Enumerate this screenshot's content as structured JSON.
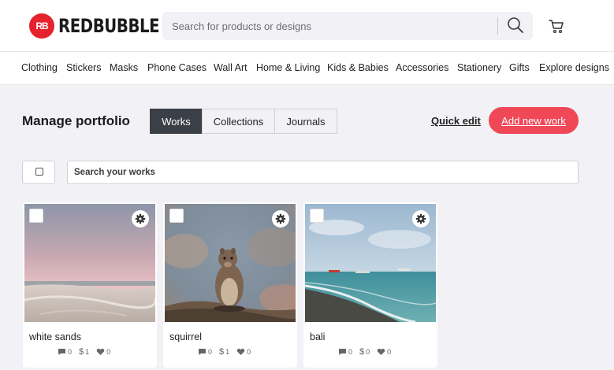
{
  "brand": {
    "mark": "RB",
    "name": "REDBUBBLE",
    "color": "#e4232d"
  },
  "search": {
    "placeholder": "Search for products or designs"
  },
  "icons": {
    "search": "search-icon",
    "cart": "cart-icon",
    "gear": "gear-icon",
    "comment": "comment-icon",
    "heart": "heart-icon"
  },
  "nav": {
    "items": [
      "Clothing",
      "Stickers",
      "Masks",
      "Phone Cases",
      "Wall Art",
      "Home & Living",
      "Kids & Babies",
      "Accessories",
      "Stationery",
      "Gifts",
      "Explore designs"
    ]
  },
  "portfolio": {
    "title": "Manage portfolio",
    "tabs": [
      "Works",
      "Collections",
      "Journals"
    ],
    "active_tab": "Works",
    "quick_edit": "Quick edit",
    "add_work": "Add new work",
    "works_search_placeholder": "Search your works"
  },
  "works": [
    {
      "title": "white sands",
      "comments": "0",
      "sales": "1",
      "favorites": "0"
    },
    {
      "title": "squirrel",
      "comments": "0",
      "sales": "1",
      "favorites": "0"
    },
    {
      "title": "bali",
      "comments": "0",
      "sales": "0",
      "favorites": "0"
    }
  ],
  "colors": {
    "accent": "#f04857",
    "active_tab": "#3b3f48"
  }
}
